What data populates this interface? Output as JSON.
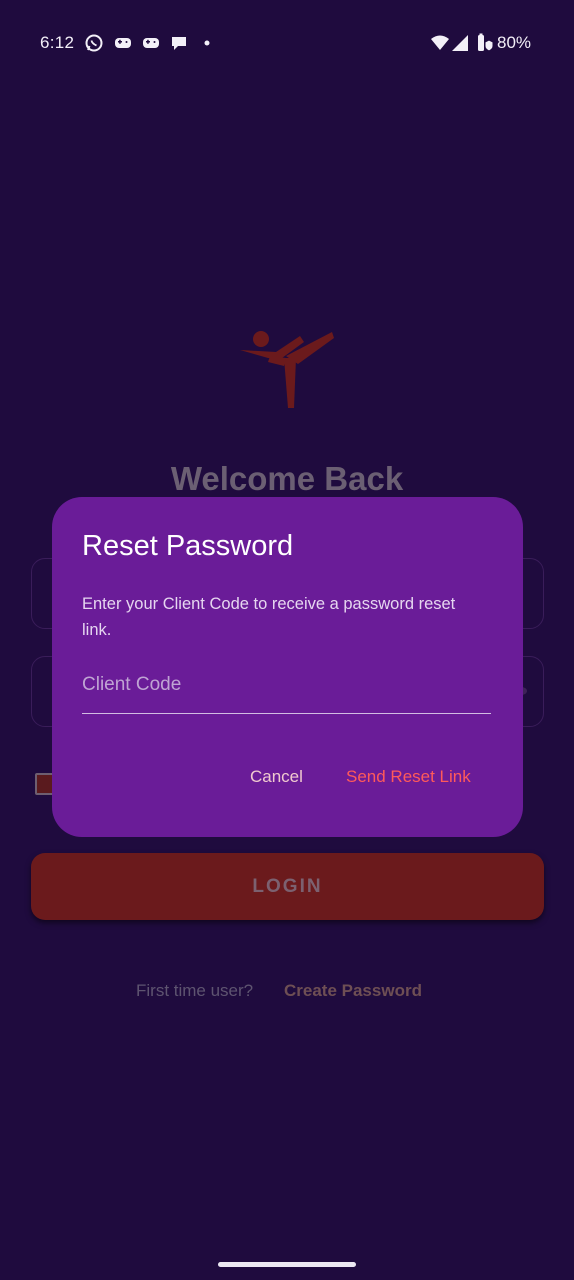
{
  "status_bar": {
    "time": "6:12",
    "battery": "80%",
    "icons": [
      "whatsapp-icon",
      "game-controller-icon",
      "game-controller-icon",
      "chat-bubble-icon",
      "dot-icon",
      "wifi-icon",
      "signal-icon",
      "battery-saver-icon"
    ]
  },
  "background": {
    "welcome_title": "Welcome Back",
    "login_label": "LOGIN",
    "first_time_text": "First time user?",
    "create_password_label": "Create Password",
    "help_glyph": "?"
  },
  "dialog": {
    "title": "Reset Password",
    "description": "Enter your Client Code to receive a password reset link.",
    "input_placeholder": "Client Code",
    "cancel_label": "Cancel",
    "send_label": "Send Reset Link"
  },
  "colors": {
    "background": "#1f0b3e",
    "dialog": "#6a1c98",
    "accent": "#ff5a5a",
    "login_button": "#6b1a1c"
  }
}
